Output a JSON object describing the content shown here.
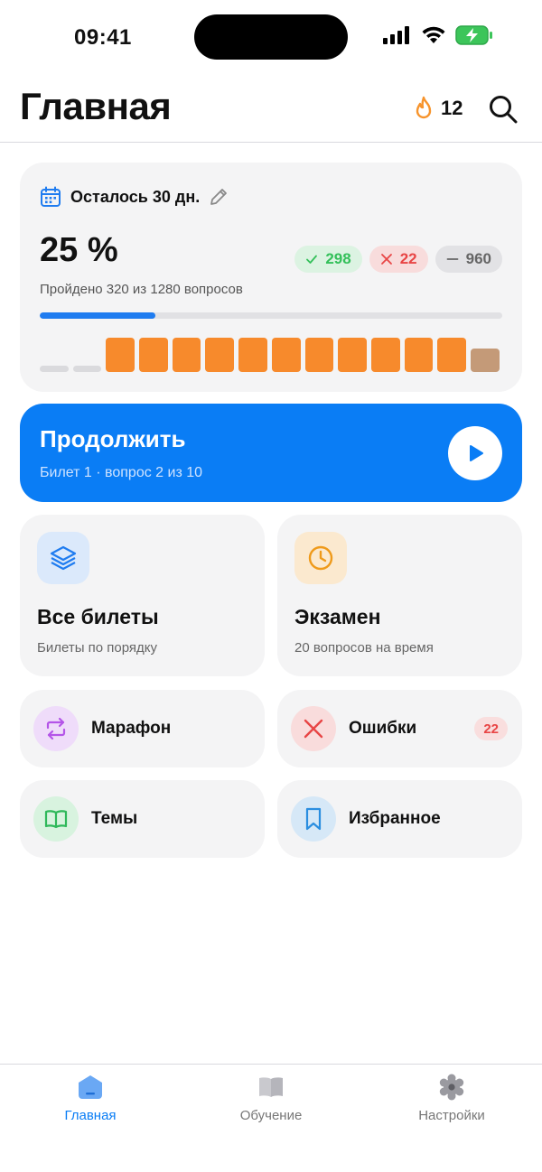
{
  "status_bar": {
    "time": "09:41"
  },
  "header": {
    "title": "Главная",
    "streak": "12"
  },
  "progress": {
    "deadline": "Осталось 30 дн.",
    "percent": "25 %",
    "percent_value": 25,
    "passed_text": "Пройдено 320 из 1280 вопросов",
    "correct": "298",
    "wrong": "22",
    "skipped": "960",
    "tickets": [
      "empty",
      "empty",
      "done",
      "done",
      "done",
      "done",
      "done",
      "done",
      "done",
      "done",
      "done",
      "done",
      "done",
      "current"
    ]
  },
  "continue": {
    "title": "Продолжить",
    "subtitle": "Билет 1 · вопрос 2 из 10"
  },
  "tiles": {
    "all_tickets": {
      "title": "Все билеты",
      "subtitle": "Билеты по порядку"
    },
    "exam": {
      "title": "Экзамен",
      "subtitle": "20 вопросов на время"
    },
    "marathon": {
      "title": "Марафон"
    },
    "mistakes": {
      "title": "Ошибки",
      "badge": "22"
    },
    "topics": {
      "title": "Темы"
    },
    "favorites": {
      "title": "Избранное"
    }
  },
  "tab_bar": {
    "home": "Главная",
    "learning": "Обучение",
    "settings": "Настройки"
  },
  "colors": {
    "accent": "#0a7df5",
    "orange": "#f78a2c",
    "correct": "#34c05a",
    "wrong": "#e84545"
  }
}
